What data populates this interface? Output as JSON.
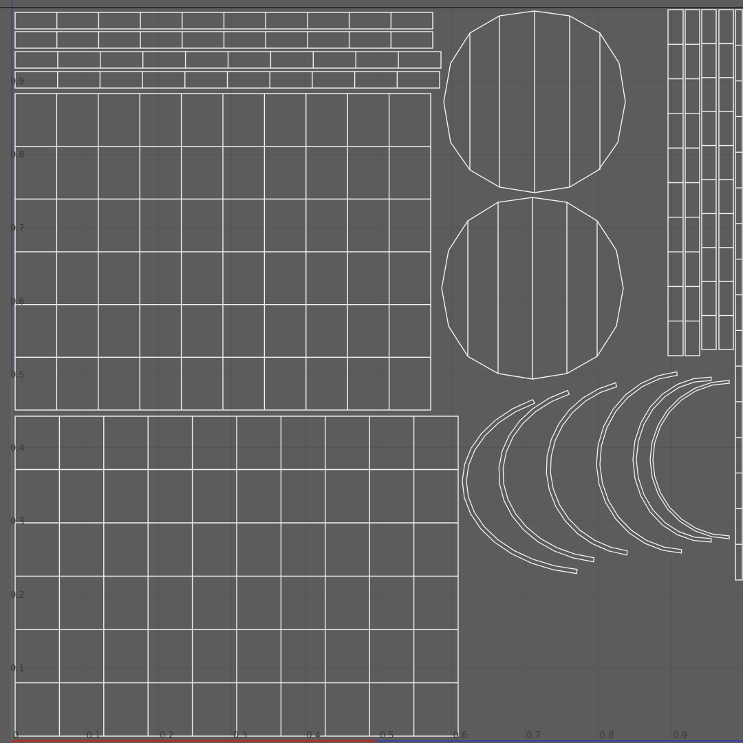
{
  "editor": {
    "view_name": "uv-texture-editor",
    "colors": {
      "background": "#5c5c5c",
      "grid": "#545454",
      "wire": "#f2f2f2",
      "u_axis": "#b03030",
      "v_axis_blue": "#3a44a8",
      "v_axis_green": "#3c8a3c",
      "label": "#3a3a3a"
    }
  },
  "axes": {
    "u_ticks": [
      "0",
      "0.1",
      "0.2",
      "0.3",
      "0.4",
      "0.5",
      "0.6",
      "0.7",
      "0.8",
      "0.9"
    ],
    "v_ticks": [
      "0.1",
      "0.2",
      "0.3",
      "0.4",
      "0.5",
      "0.6",
      "0.7",
      "0.8",
      "0.9"
    ]
  }
}
